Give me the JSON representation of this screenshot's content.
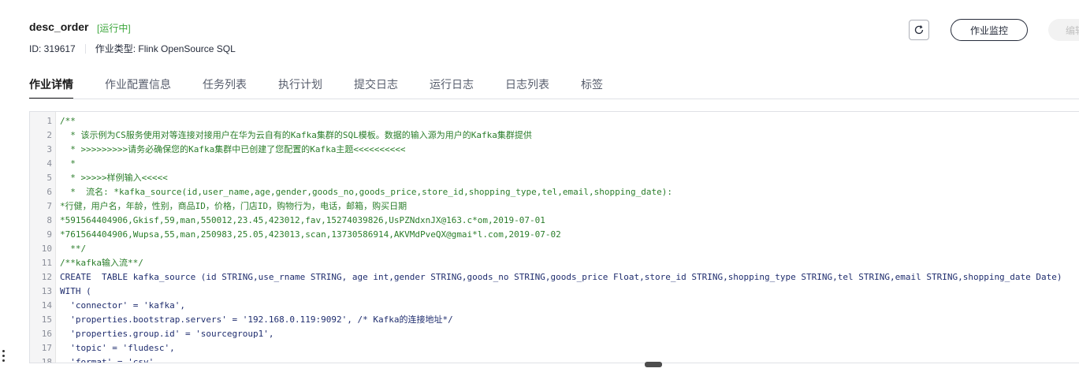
{
  "header": {
    "job_name": "desc_order",
    "status": "[运行中]",
    "id_text": "ID: 319617",
    "type_text": "作业类型: Flink OpenSource SQL",
    "monitor_label": "作业监控",
    "edit_label": "编辑"
  },
  "colors": {
    "status": "#3ba63b",
    "accent": "#191919"
  },
  "tabs": [
    {
      "label": "作业详情",
      "active": true
    },
    {
      "label": "作业配置信息",
      "active": false
    },
    {
      "label": "任务列表",
      "active": false
    },
    {
      "label": "执行计划",
      "active": false
    },
    {
      "label": "提交日志",
      "active": false
    },
    {
      "label": "运行日志",
      "active": false
    },
    {
      "label": "日志列表",
      "active": false
    },
    {
      "label": "标签",
      "active": false
    }
  ],
  "editor": {
    "lines": [
      {
        "n": "1",
        "text": "/**",
        "kind": "comment"
      },
      {
        "n": "2",
        "text": "  * 该示例为CS服务使用对等连接对接用户在华为云自有的Kafka集群的SQL模板。数据的输入源为用户的Kafka集群提供",
        "kind": "comment"
      },
      {
        "n": "3",
        "text": "  * >>>>>>>>>请务必确保您的Kafka集群中已创建了您配置的Kafka主题<<<<<<<<<<",
        "kind": "comment"
      },
      {
        "n": "4",
        "text": "  *",
        "kind": "comment"
      },
      {
        "n": "5",
        "text": "  * >>>>>样例输入<<<<<",
        "kind": "comment"
      },
      {
        "n": "6",
        "text": "  *  流名: *kafka_source(id,user_name,age,gender,goods_no,goods_price,store_id,shopping_type,tel,email,shopping_date):",
        "kind": "comment"
      },
      {
        "n": "7",
        "text": "*行健，用户名，年龄，性别，商品ID，价格，门店ID，购物行为，电话，邮箱，购买日期",
        "kind": "comment"
      },
      {
        "n": "8",
        "text": "*591564404906,Gkisf,59,man,550012,23.45,423012,fav,15274039826,UsPZNdxnJX@163.c*om,2019-07-01",
        "kind": "comment"
      },
      {
        "n": "9",
        "text": "*761564404906,Wupsa,55,man,250983,25.05,423013,scan,13730586914,AKVMdPveQX@gmai*l.com,2019-07-02",
        "kind": "comment"
      },
      {
        "n": "10",
        "text": "  **/",
        "kind": "comment"
      },
      {
        "n": "11",
        "text": "/**kafka输入流**/",
        "kind": "comment"
      },
      {
        "n": "12",
        "text": "CREATE  TABLE kafka_source (id STRING,use_rname STRING, age int,gender STRING,goods_no STRING,goods_price Float,store_id STRING,shopping_type STRING,tel STRING,email STRING,shopping_date Date)",
        "kind": "code"
      },
      {
        "n": "13",
        "text": "WITH (",
        "kind": "code"
      },
      {
        "n": "14",
        "text": "  'connector' = 'kafka',",
        "kind": "code"
      },
      {
        "n": "15",
        "text": "  'properties.bootstrap.servers' = '192.168.0.119:9092', /* Kafka的连接地址*/",
        "kind": "code"
      },
      {
        "n": "16",
        "text": "  'properties.group.id' = 'sourcegroup1',",
        "kind": "code"
      },
      {
        "n": "17",
        "text": "  'topic' = 'fludesc',",
        "kind": "code"
      },
      {
        "n": "18",
        "text": "  'format' = 'csv',",
        "kind": "code"
      }
    ]
  },
  "icons": {
    "refresh": "refresh-icon",
    "resize": "resize-handle-icon",
    "side": "side-drag-icon"
  }
}
